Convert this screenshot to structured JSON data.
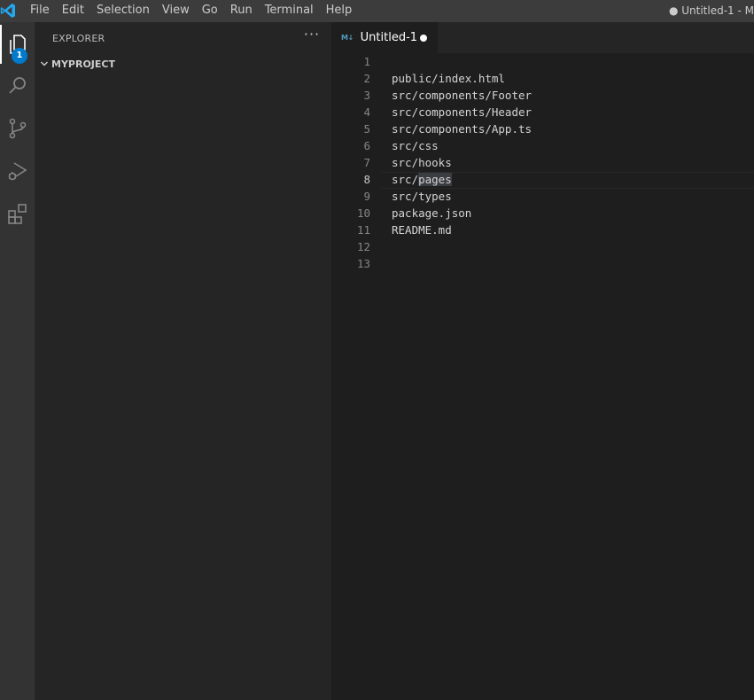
{
  "titlebar": {
    "menu": [
      "File",
      "Edit",
      "Selection",
      "View",
      "Go",
      "Run",
      "Terminal",
      "Help"
    ],
    "window_title": "● Untitled-1 - M"
  },
  "activitybar": {
    "items": [
      "explorer-icon",
      "search-icon",
      "source-control-icon",
      "run-debug-icon",
      "extensions-icon"
    ],
    "explorer_badge": "1",
    "accent": "#007acc"
  },
  "sidebar": {
    "title": "EXPLORER",
    "more": "···",
    "folder": "MYPROJECT"
  },
  "editor": {
    "tab_label": "Untitled-1",
    "tab_icon": "M↓",
    "active_line": 8,
    "lines": [
      {
        "n": "1",
        "text": ""
      },
      {
        "n": "2",
        "text": "public/index.html"
      },
      {
        "n": "3",
        "text": "src/components/Footer"
      },
      {
        "n": "4",
        "text": "src/components/Header"
      },
      {
        "n": "5",
        "text": "src/components/App.ts"
      },
      {
        "n": "6",
        "text": "src/css"
      },
      {
        "n": "7",
        "text": "src/hooks"
      },
      {
        "n": "8",
        "text_before": "src/",
        "text_selected": "pages"
      },
      {
        "n": "9",
        "text": "src/types"
      },
      {
        "n": "10",
        "text": "package.json"
      },
      {
        "n": "11",
        "text": "README.md"
      },
      {
        "n": "12",
        "text": ""
      },
      {
        "n": "13",
        "text": ""
      }
    ]
  }
}
